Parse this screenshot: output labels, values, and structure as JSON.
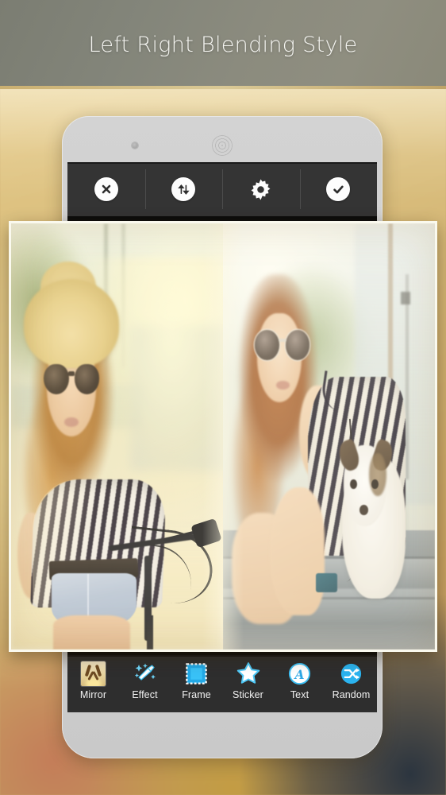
{
  "header": {
    "title": "Left Right Blending Style"
  },
  "device": {
    "speaker_icon": "speaker-grille-icon",
    "camera_icon": "front-camera-icon"
  },
  "top_toolbar": {
    "buttons": [
      {
        "name": "cancel",
        "label": "Cancel",
        "icon": "close-icon"
      },
      {
        "name": "swap",
        "label": "Swap",
        "icon": "swap-vertical-icon"
      },
      {
        "name": "settings",
        "label": "Settings",
        "icon": "gear-icon"
      },
      {
        "name": "confirm",
        "label": "Done",
        "icon": "check-circle-icon"
      }
    ]
  },
  "bottom_toolbar": {
    "items": [
      {
        "label": "Mirror",
        "icon": "mirror-thumbnail-icon"
      },
      {
        "label": "Effect",
        "icon": "magic-wand-icon"
      },
      {
        "label": "Frame",
        "icon": "frame-square-icon"
      },
      {
        "label": "Sticker",
        "icon": "star-icon"
      },
      {
        "label": "Text",
        "icon": "text-a-circle-icon"
      },
      {
        "label": "Random",
        "icon": "shuffle-circle-icon"
      }
    ]
  },
  "collage": {
    "style": "Left Right Blending Style",
    "left_panel": {
      "description": "Young woman in straw hat and sunglasses with striped top standing by a bicycle in warm sunlight"
    },
    "right_panel": {
      "description": "Young woman in aviator sunglasses and striped top sitting on concrete steps with a Jack Russell terrier"
    }
  },
  "colors": {
    "header_text": "#f4f4f0",
    "toolbar_dark": "#343434",
    "toolbar_bottom": "#2e2e2e",
    "icon_accent": "#2fb6f0",
    "icon_white": "#ffffff",
    "background_gold": "#cfae6e"
  }
}
